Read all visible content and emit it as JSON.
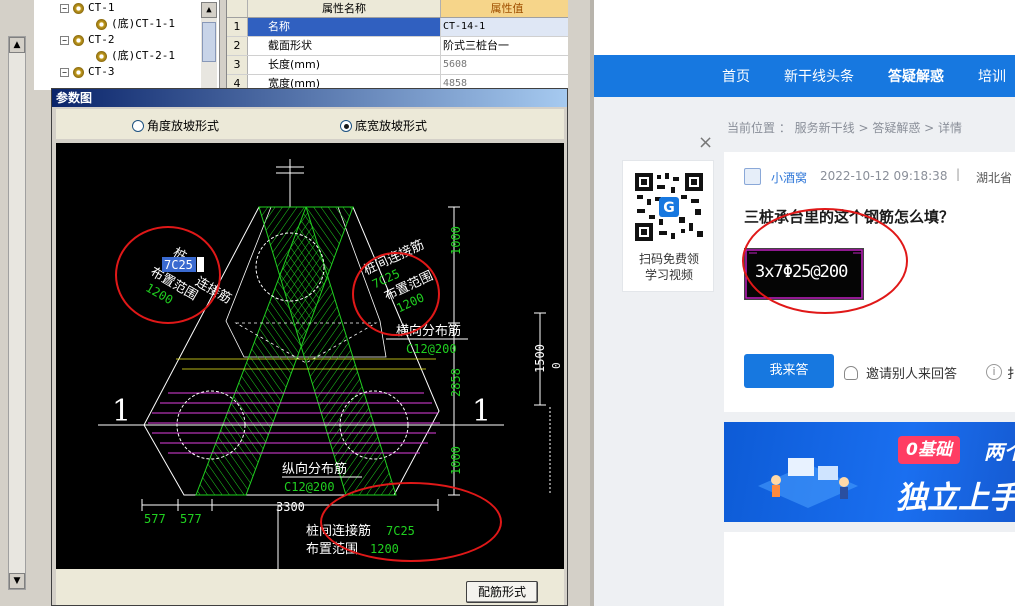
{
  "tree": {
    "items": [
      {
        "toggle": "−",
        "label": "CT-1"
      },
      {
        "toggle": "",
        "label": "(底)CT-1-1"
      },
      {
        "toggle": "−",
        "label": "CT-2"
      },
      {
        "toggle": "",
        "label": "(底)CT-2-1"
      },
      {
        "toggle": "−",
        "label": "CT-3"
      }
    ],
    "scroll_up": "▲",
    "outer_up": "▲",
    "outer_down": "▼"
  },
  "props": {
    "header_name": "属性名称",
    "header_value": "属性值",
    "rows": [
      {
        "idx": "1",
        "name": "名称",
        "value": "CT-14-1"
      },
      {
        "idx": "2",
        "name": "截面形状",
        "value": "阶式三桩台一"
      },
      {
        "idx": "3",
        "name": "长度(mm)",
        "value": "5608"
      },
      {
        "idx": "4",
        "name": "宽度(mm)",
        "value": "4858"
      }
    ]
  },
  "dialog": {
    "title": "参数图",
    "radio_angle": "角度放坡形式",
    "radio_width": "底宽放坡形式",
    "radio_selected": "width",
    "button_rebar": "配筋形式"
  },
  "drawing": {
    "section_mark_left": "1",
    "section_mark_right": "1",
    "left_label_1": "桩",
    "left_label_selected": "7C25",
    "left_label_2": "连接筋",
    "left_label_3": "布置范围",
    "left_value": "1200",
    "right_label_1": "桩间连接筋",
    "right_value_1": "7C25",
    "right_label_2": "布置范围",
    "right_value_2": "1200",
    "transverse_label": "横向分布筋",
    "transverse_value": "C12@200",
    "longitudinal_label": "纵向分布筋",
    "longitudinal_value": "C12@200",
    "bottom_label_1": "桩间连接筋",
    "bottom_value_1": "7C25",
    "bottom_label_2": "布置范围",
    "bottom_value_2": "1200",
    "dim_1000_top": "1000",
    "dim_2858": "2858",
    "dim_1000_bottom": "1000",
    "dim_1500": "1500",
    "dim_0": "0",
    "dim_3300": "3300",
    "dim_577_a": "577",
    "dim_577_b": "577"
  },
  "web": {
    "nav": [
      "首页",
      "新干线头条",
      "答疑解惑",
      "培训"
    ],
    "nav_active": 2,
    "breadcrumb": "当前位置 ： 服务新干线 > 答疑解惑 > 详情",
    "close": "×",
    "qr_text": "扫码免费领\n学习视频",
    "author": "小酒窝",
    "date": "2022-10-12 09:18:38",
    "divider": "|",
    "region": "湖北省",
    "question": "三桩承台里的这个钢筋怎么填？",
    "image_text": "3x7Φ25@200",
    "answer_button": "我来答",
    "invite": "邀请别人来回答",
    "info_icon": "i",
    "more_short": "扌",
    "banner_pill": "0基础",
    "banner_pill_after": "两个",
    "banner_big": "独立上手"
  },
  "colors": {
    "nav_blue": "#1778e0",
    "annotation_red": "#e01818",
    "cad_green": "#20d020",
    "cad_magenta": "#e040e0",
    "cad_white": "#ffffff",
    "cad_yellow": "#f0f020"
  }
}
